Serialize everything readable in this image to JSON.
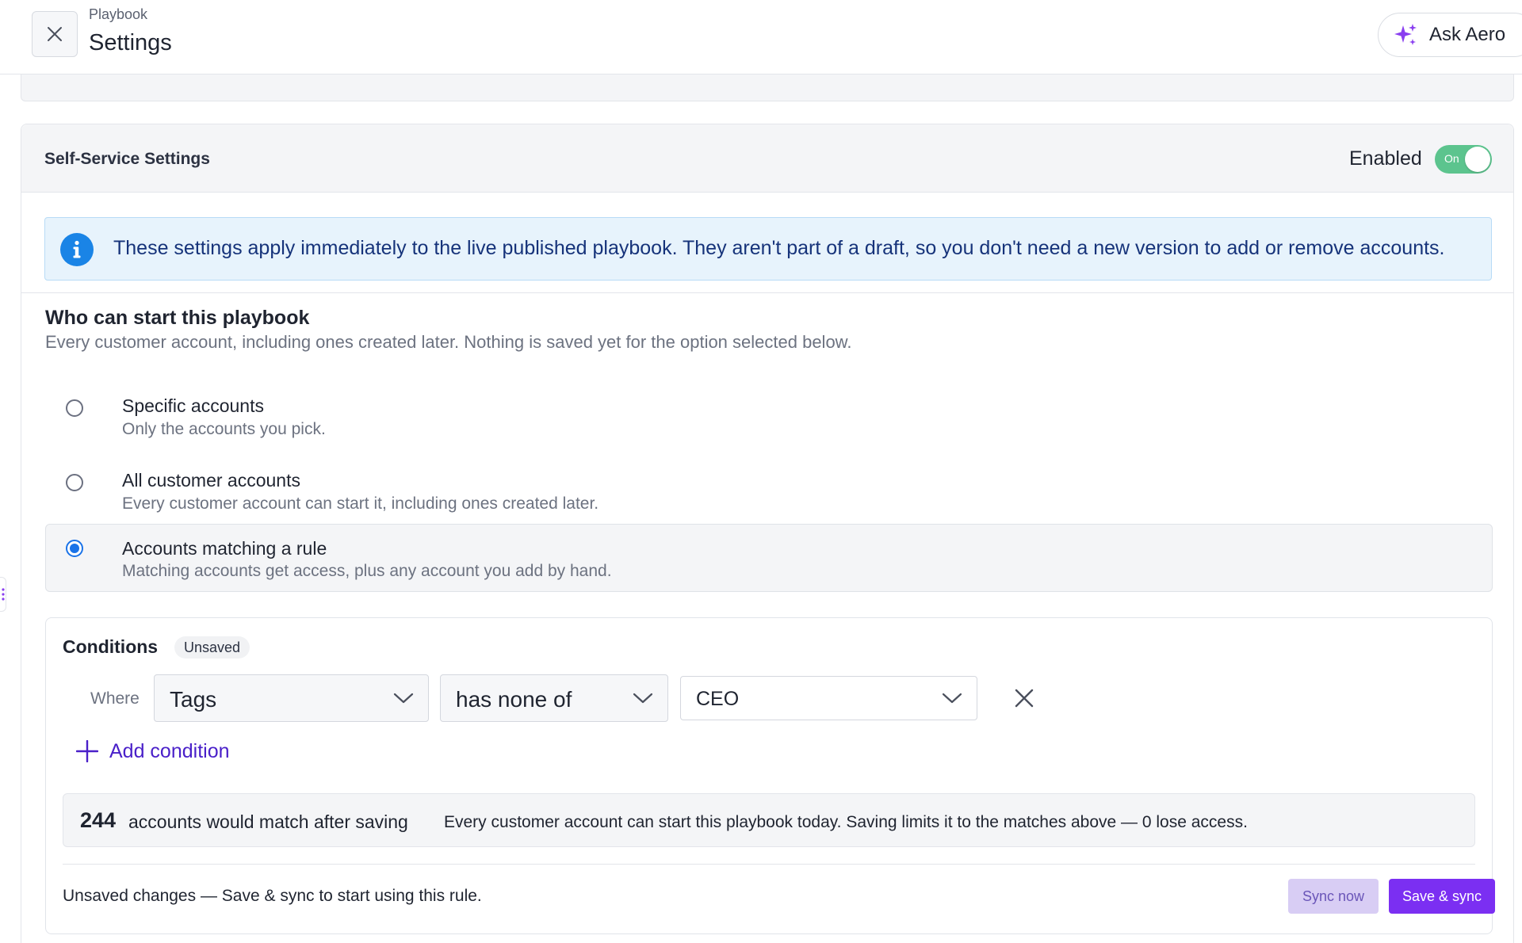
{
  "header": {
    "breadcrumb": "Playbook",
    "title": "Settings",
    "ask_label": "Ask Aero"
  },
  "self_service": {
    "title": "Self-Service Settings",
    "enabled_label": "Enabled",
    "toggle_text": "On",
    "toggle_state": true,
    "info_text": "These settings apply immediately to the live published playbook. They aren't part of a draft, so you don't need a new version to add or remove accounts."
  },
  "access": {
    "title": "Who can start this playbook",
    "subtitle": "Every customer account, including ones created later. Nothing is saved yet for the option selected below.",
    "options": [
      {
        "title": "Specific accounts",
        "sub": "Only the accounts you pick.",
        "selected": false
      },
      {
        "title": "All customer accounts",
        "sub": "Every customer account can start it, including ones created later.",
        "selected": false
      },
      {
        "title": "Accounts matching a rule",
        "sub": "Matching accounts get access, plus any account you add by hand.",
        "selected": true
      }
    ]
  },
  "conditions": {
    "title": "Conditions",
    "badge": "Unsaved",
    "where_label": "Where",
    "field": "Tags",
    "operator": "has none of",
    "value": "CEO",
    "add_label": "Add condition",
    "match_count": "244",
    "match_label": "accounts would match after saving",
    "match_note": "Every customer account can start this playbook today. Saving limits it to the matches above — 0 lose access.",
    "footer_text": "Unsaved changes — Save & sync to start using this rule.",
    "sync_label": "Sync now",
    "save_label": "Save & sync"
  },
  "colors": {
    "accent": "#7b2ff2",
    "toggle_on": "#5cc48e",
    "info_bg": "#e7f3fc",
    "radio_selected": "#1a73e8",
    "link": "#4a20c9"
  },
  "icons": [
    "close-icon",
    "sparkle-icon",
    "info-icon",
    "chevron-down-icon",
    "remove-icon",
    "plus-icon",
    "drag-handle-icon"
  ]
}
